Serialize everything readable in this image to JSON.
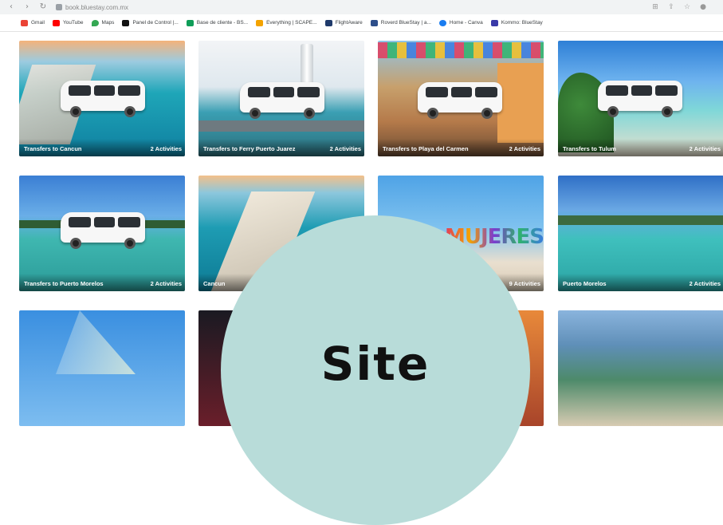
{
  "browser": {
    "url": "book.bluestay.com.mx",
    "bookmarks": [
      {
        "label": "Gmail",
        "icon": "gmail-icon",
        "color": "#ea4335"
      },
      {
        "label": "YouTube",
        "icon": "youtube-icon",
        "color": "#ff0000"
      },
      {
        "label": "Maps",
        "icon": "maps-icon",
        "color": "#34a853"
      },
      {
        "label": "Panel de Control |...",
        "icon": "wix-icon",
        "color": "#111111"
      },
      {
        "label": "Base de cliente - BS...",
        "icon": "sheets-icon",
        "color": "#0f9d58"
      },
      {
        "label": "Everything | SCAPE...",
        "icon": "scape-icon",
        "color": "#f4a300"
      },
      {
        "label": "FlightAware",
        "icon": "flightaware-icon",
        "color": "#1f3a6b"
      },
      {
        "label": "Roverd BlueStay | a...",
        "icon": "roverd-icon",
        "color": "#2d4e8a"
      },
      {
        "label": "Home - Canva",
        "icon": "canva-icon",
        "color": "#1a7cf0"
      },
      {
        "label": "Kommo: BlueStay",
        "icon": "kommo-icon",
        "color": "#3a3aa8"
      }
    ]
  },
  "cards": [
    {
      "title": "Transfers to Cancun",
      "count": "2 Activities"
    },
    {
      "title": "Transfers to Ferry Puerto Juarez",
      "count": "2 Activities"
    },
    {
      "title": "Transfers to Playa del Carmen",
      "count": "2 Activities"
    },
    {
      "title": "Transfers to Tulum",
      "count": "2 Activities"
    },
    {
      "title": "Transfers to Puerto Morelos",
      "count": "2 Activities"
    },
    {
      "title": "Cancun",
      "count": ""
    },
    {
      "title": "",
      "count": "9 Activities"
    },
    {
      "title": "Puerto Morelos",
      "count": "2 Activities"
    }
  ],
  "overlay": {
    "text": "Site",
    "sign_text": "MUJERES"
  }
}
